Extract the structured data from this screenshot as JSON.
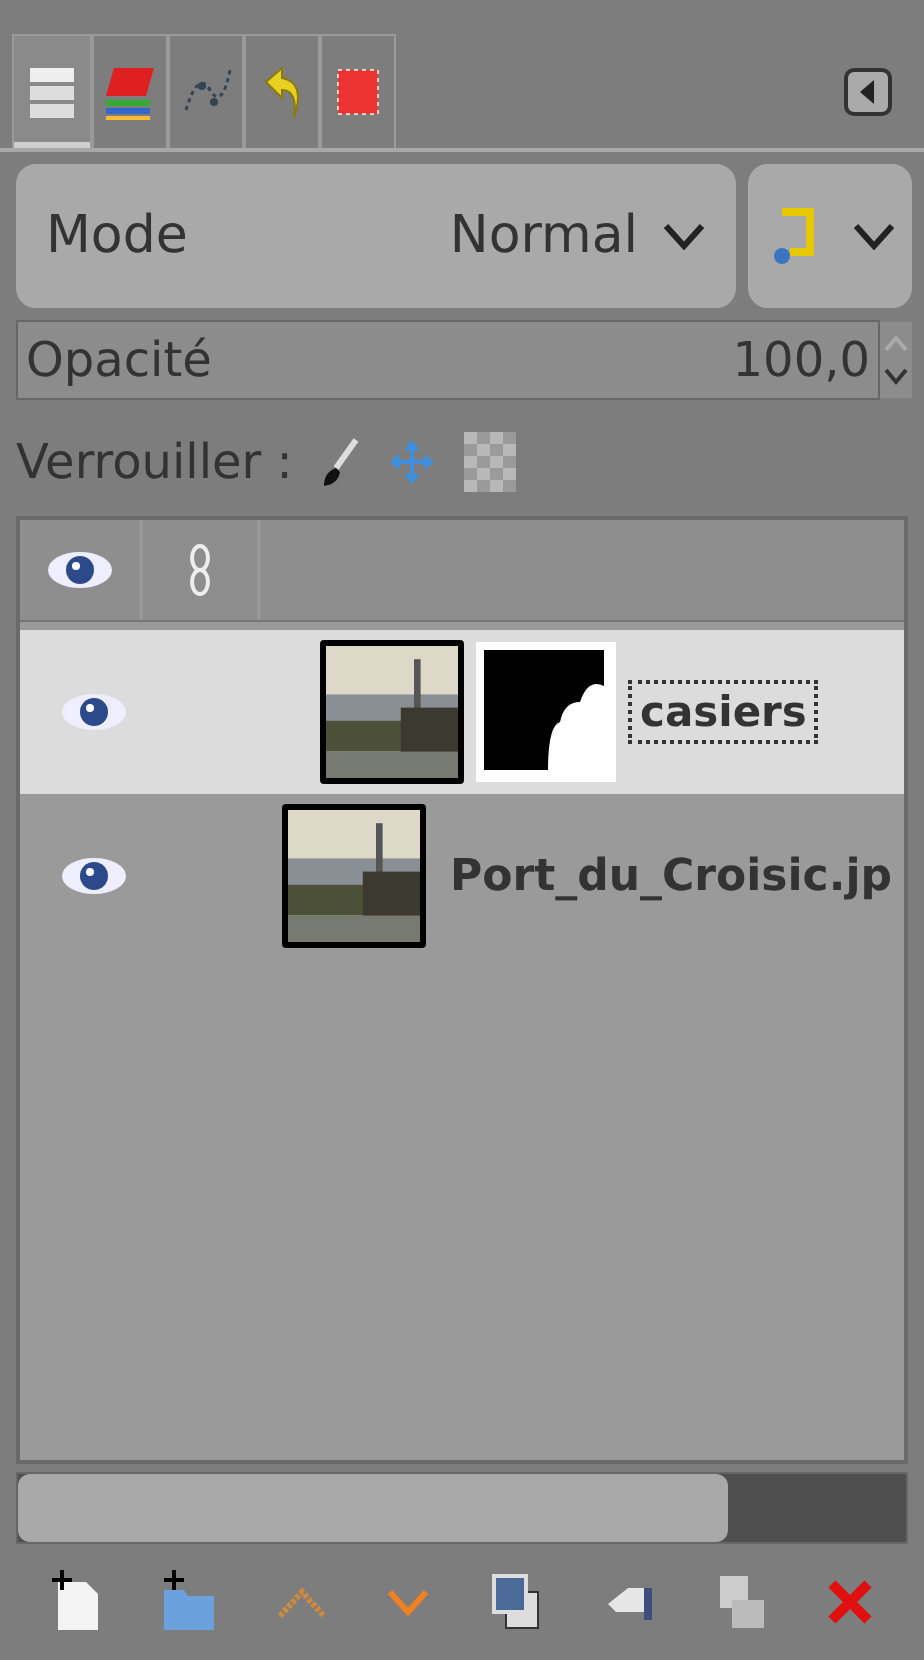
{
  "tabs": [
    {
      "selected": true
    },
    {
      "selected": false
    },
    {
      "selected": false
    },
    {
      "selected": false
    },
    {
      "selected": false
    }
  ],
  "mode": {
    "label": "Mode",
    "value": "Normal"
  },
  "opacity": {
    "label": "Opacité",
    "value": "100,0"
  },
  "lock": {
    "label": "Verrouiller :"
  },
  "layers": [
    {
      "name": "casiers",
      "selected": true,
      "visible": true,
      "has_mask": true
    },
    {
      "name": "Port_du_Croisic.jp",
      "selected": false,
      "visible": true,
      "has_mask": false
    }
  ],
  "scrollbar": {
    "level": 0.8
  }
}
